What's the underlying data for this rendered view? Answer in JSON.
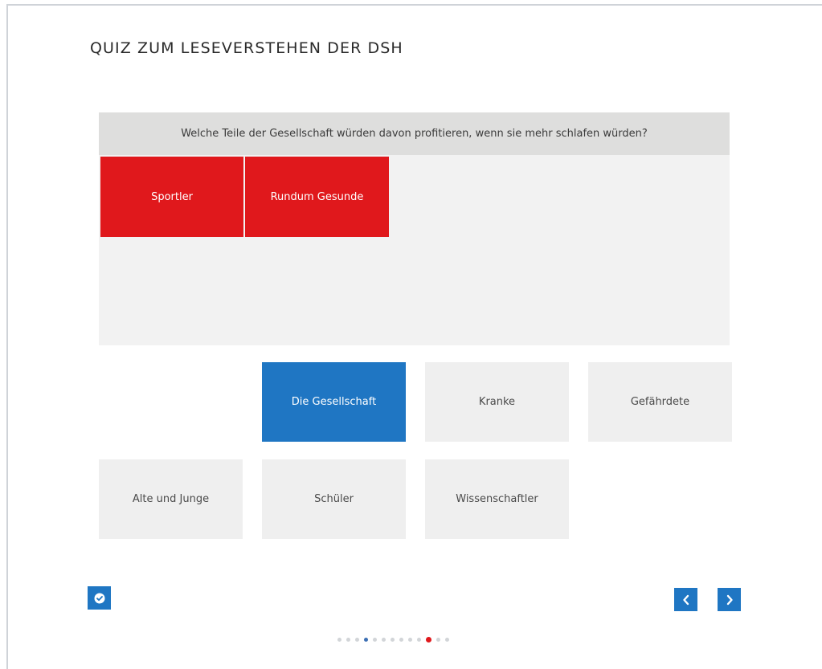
{
  "quiz": {
    "title": "QUIZ ZUM LESEVERSTEHEN DER DSH",
    "question": "Welche Teile der Gesellschaft würden davon profitieren, wenn sie mehr schlafen würden?"
  },
  "placed_answers": [
    {
      "label": "Sportler"
    },
    {
      "label": "Rundum Gesunde"
    }
  ],
  "options": [
    {
      "label": "Die Gesellschaft",
      "selected": true
    },
    {
      "label": "Kranke",
      "selected": false
    },
    {
      "label": "Gefährdete",
      "selected": false
    },
    {
      "label": "Alte und Junge",
      "selected": false
    },
    {
      "label": "Schüler",
      "selected": false
    },
    {
      "label": "Wissenschaftler",
      "selected": false
    }
  ],
  "controls": {
    "check_icon": "check-circle-icon",
    "prev_icon": "chevron-left-icon",
    "next_icon": "chevron-right-icon"
  },
  "pagination": {
    "total": 13,
    "visited_index": 3,
    "current_index": 10
  },
  "colors": {
    "accent_blue": "#1f76c3",
    "accent_red": "#e0181c",
    "tile_gray": "#efefef",
    "question_bar": "#dededd",
    "drop_area": "#f2f2f2"
  }
}
